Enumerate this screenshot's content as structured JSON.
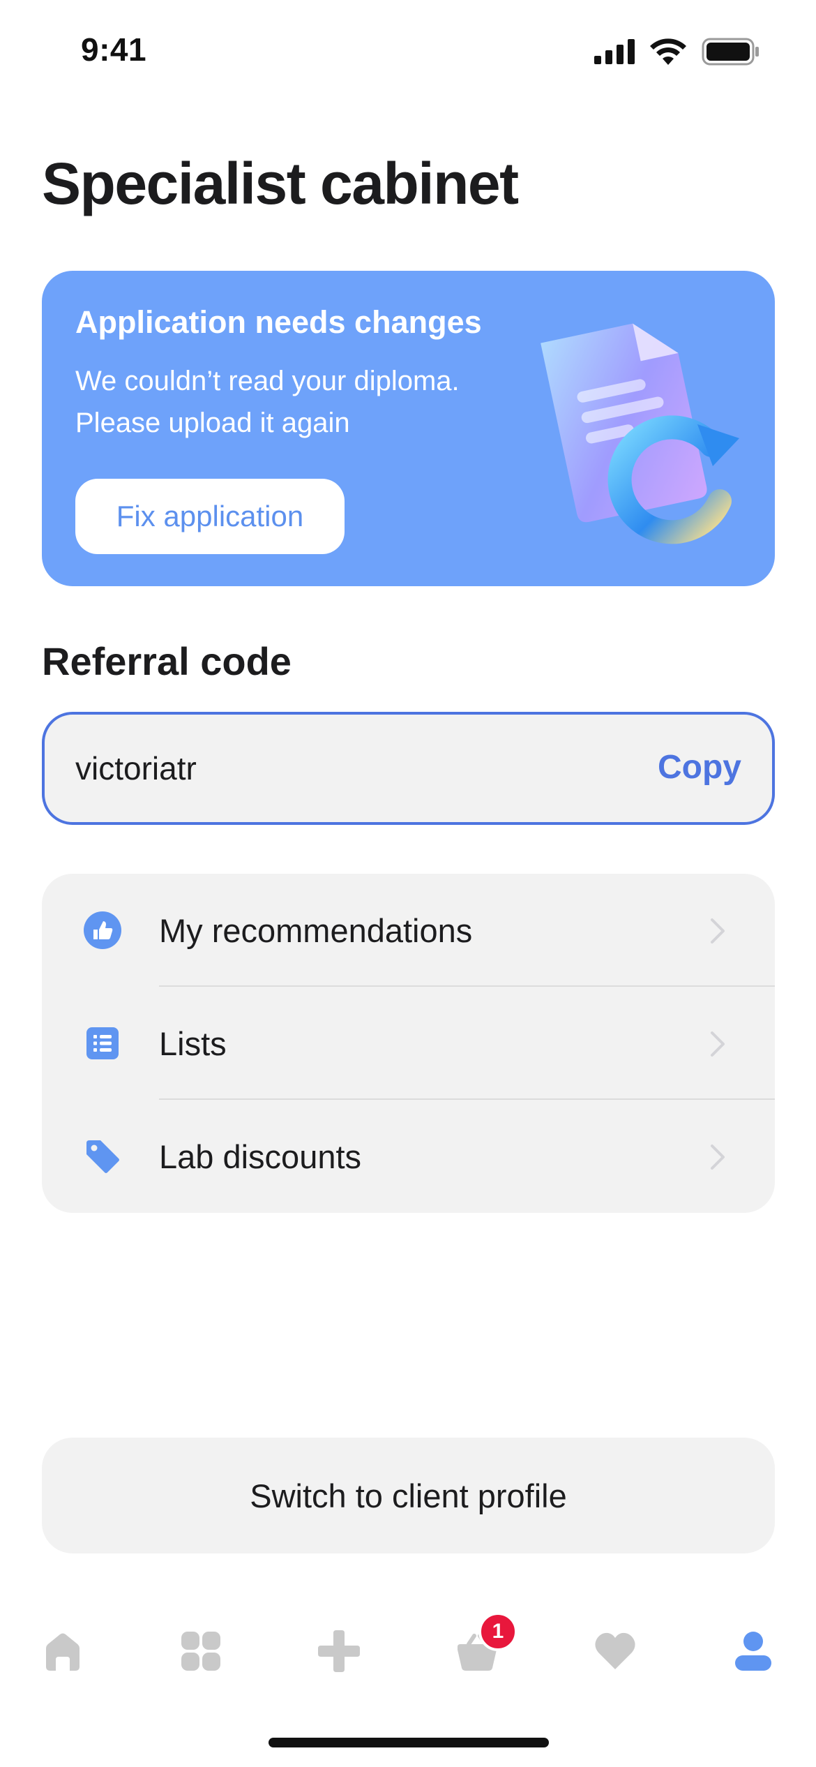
{
  "status_bar": {
    "time": "9:41"
  },
  "page": {
    "title": "Specialist cabinet"
  },
  "banner": {
    "title": "Application needs changes",
    "text_line1": "We couldn’t read your diploma.",
    "text_line2": "Please upload it again",
    "button_label": "Fix application"
  },
  "referral": {
    "section_title": "Referral code",
    "value": "victoriatr",
    "copy_label": "Copy"
  },
  "menu": {
    "items": [
      {
        "label": "My recommendations",
        "icon": "thumbs-up-icon"
      },
      {
        "label": "Lists",
        "icon": "list-icon"
      },
      {
        "label": "Lab discounts",
        "icon": "tag-icon"
      }
    ]
  },
  "switch_button": {
    "label": "Switch to client profile"
  },
  "tab_bar": {
    "tabs": [
      {
        "name": "home",
        "icon": "home-icon",
        "active": false
      },
      {
        "name": "catalog",
        "icon": "grid-icon",
        "active": false
      },
      {
        "name": "health",
        "icon": "plus-cross-icon",
        "active": false
      },
      {
        "name": "cart",
        "icon": "basket-icon",
        "active": false,
        "badge": "1"
      },
      {
        "name": "favorites",
        "icon": "heart-icon",
        "active": false
      },
      {
        "name": "profile",
        "icon": "profile-icon",
        "active": true
      }
    ]
  },
  "colors": {
    "accent": "#4d74e0",
    "banner_bg": "#6ea2fa",
    "icon_blue": "#5f95f1",
    "tab_inactive": "#c9c9c9",
    "badge": "#e8173c"
  }
}
